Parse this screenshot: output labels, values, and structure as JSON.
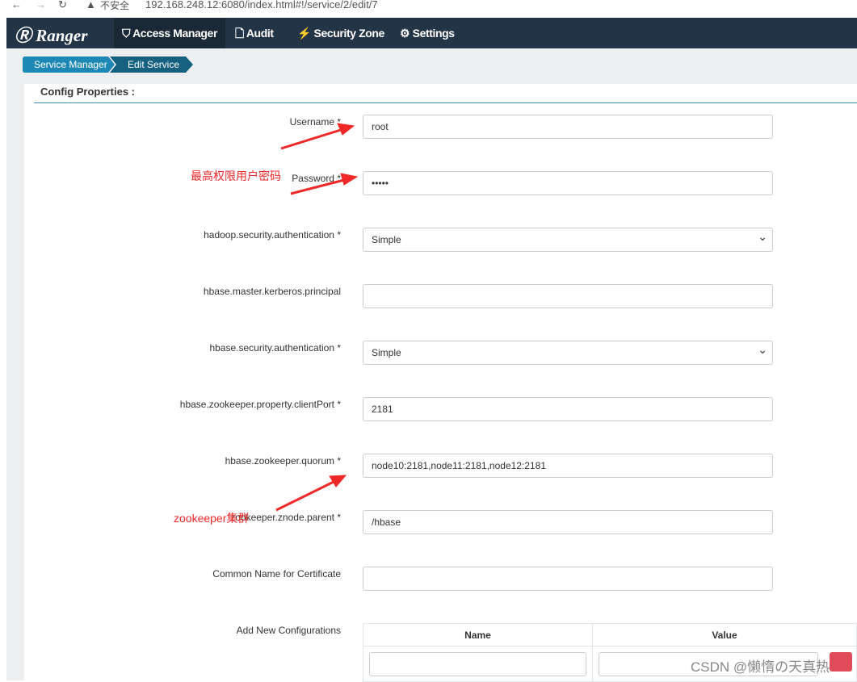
{
  "browser": {
    "security": "不安全",
    "url": "192.168.248.12:6080/index.html#!/service/2/edit/7"
  },
  "nav": {
    "brand": "Ranger",
    "items": [
      {
        "label": "Access Manager"
      },
      {
        "label": "Audit"
      },
      {
        "label": "Security Zone"
      },
      {
        "label": "Settings"
      }
    ]
  },
  "breadcrumb": [
    "Service Manager",
    "Edit Service"
  ],
  "section_title": "Config Properties :",
  "fields": [
    {
      "label": "Username *",
      "value": "root"
    },
    {
      "label": "Password *",
      "value": "•••••"
    },
    {
      "label": "hadoop.security.authentication *",
      "value": "Simple"
    },
    {
      "label": "hbase.master.kerberos.principal",
      "value": ""
    },
    {
      "label": "hbase.security.authentication *",
      "value": "Simple"
    },
    {
      "label": "hbase.zookeeper.property.clientPort *",
      "value": "2181"
    },
    {
      "label": "hbase.zookeeper.quorum *",
      "value": "node10:2181,node11:2181,node12:2181"
    },
    {
      "label": "zookeeper.znode.parent *",
      "value": "/hbase"
    },
    {
      "label": "Common Name for Certificate",
      "value": ""
    }
  ],
  "add_config": {
    "label": "Add New Configurations",
    "columns": [
      "Name",
      "Value"
    ]
  },
  "annotations": [
    "最高权限用户密码",
    "zookeeper集群"
  ],
  "watermark": "CSDN @懒惰の天真热"
}
